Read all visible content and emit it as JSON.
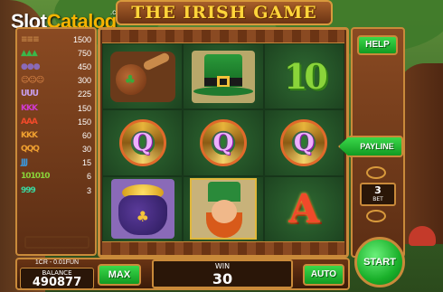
{
  "logo": {
    "text_main": "Slot",
    "text_accent": "Catalog",
    "suffix": ".com"
  },
  "title": "THE IRISH GAME",
  "paytable": [
    {
      "symbol": "pipe",
      "sym_text": "≡≡≡",
      "color": "#c98a4a",
      "value": "1500"
    },
    {
      "symbol": "hat",
      "sym_text": "▲▲▲",
      "color": "#3ab84a",
      "value": "750"
    },
    {
      "symbol": "pot",
      "sym_text": "●●●",
      "color": "#8a6ab8",
      "value": "450"
    },
    {
      "symbol": "leprechaun",
      "sym_text": "☺☺☺",
      "color": "#e08a4a",
      "value": "300"
    },
    {
      "symbol": "horseshoe",
      "sym_text": "ᑌᑌᑌ",
      "color": "#c8a0f0",
      "value": "225"
    },
    {
      "symbol": "king",
      "sym_text": "KKK",
      "color": "#d03ad0",
      "value": "150"
    },
    {
      "symbol": "ace",
      "sym_text": "AAA",
      "color": "#f04a2a",
      "value": "150"
    },
    {
      "symbol": "king-card",
      "sym_text": "KKK",
      "color": "#f0a030",
      "value": "60"
    },
    {
      "symbol": "queen",
      "sym_text": "QQQ",
      "color": "#f0a030",
      "value": "30"
    },
    {
      "symbol": "jack",
      "sym_text": "JJJ",
      "color": "#3a9ae0",
      "value": "15"
    },
    {
      "symbol": "ten",
      "sym_text": "101010",
      "color": "#8ad43a",
      "value": "6"
    },
    {
      "symbol": "nine",
      "sym_text": "999",
      "color": "#3ad8a0",
      "value": "3"
    }
  ],
  "reels": [
    [
      "pipe",
      "hat",
      "10"
    ],
    [
      "Q",
      "Q",
      "Q"
    ],
    [
      "pot",
      "leprechaun",
      "A"
    ]
  ],
  "symbols": {
    "ten": "10",
    "queen": "Q",
    "ace": "A",
    "clover": "♣"
  },
  "buttons": {
    "help": "HELP",
    "payline": "PAYLINE",
    "max": "MAX",
    "auto": "AUTO",
    "start": "START"
  },
  "bet": {
    "value": "3",
    "label": "BET"
  },
  "denomination": "1CR - 0.01FUN",
  "balance": {
    "label": "BALANCE",
    "value": "490877"
  },
  "win": {
    "label": "WIN",
    "value": "30"
  },
  "colors": {
    "accent": "#1ab02a",
    "frame": "#c98a3a",
    "title": "#ffd43b"
  }
}
